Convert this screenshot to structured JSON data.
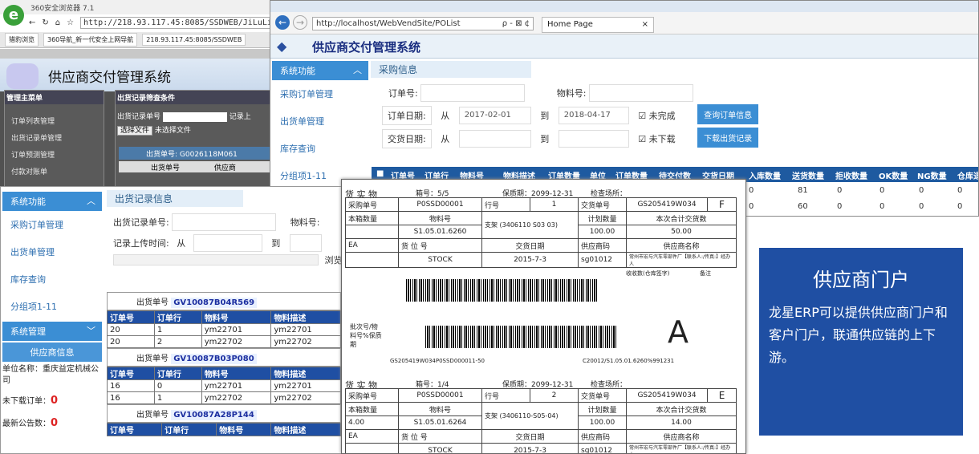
{
  "w1": {
    "title": "360安全浏览器 7.1",
    "url": "http://218.93.117.45:8085/SSDWEB/JiLuList.aspx",
    "tabs": [
      "猎豹浏览",
      "360导航_新一代安全上网导航",
      "218.93.117.45:8085/SSDWEB"
    ],
    "system_title": "供应商交付管理系统",
    "menu_title": "管理主菜单",
    "menu_items": [
      "订单列表管理",
      "出货记录单管理",
      "订单预测管理",
      "付款对账单"
    ],
    "filter_title": "出货记录筛查条件",
    "filter_label": "出货记录单号",
    "choose_file": "选择文件",
    "no_file": "未选择文件",
    "ship_no_header": "出货单号: G0026118M061",
    "col_ship": "出货单号",
    "col_supplier": "供应商",
    "record_cut": "记录上"
  },
  "w2": {
    "url": "http://localhost/WebVendSite/POList",
    "search": "ρ - ⊠ ¢",
    "tab": "Home Page",
    "system_title": "供应商交付管理系统",
    "side_title": "系统功能",
    "side_items": [
      "采购订单管理",
      "出货单管理",
      "库存查询",
      "分组项1-11"
    ],
    "section": "采购信息",
    "order_no_label": "订单号:",
    "material_label": "物料号:",
    "order_date_label": "订单日期:",
    "from": "从",
    "to": "到",
    "date_from": "2017-02-01",
    "date_to": "2018-04-17",
    "unfinished": "未完成",
    "not_downloaded": "未下载",
    "deliv_date_label": "交货日期:",
    "btn_query": "查询订单信息",
    "btn_download": "下载出货记录",
    "columns": [
      "订单号",
      "订单行",
      "物料号",
      "物料描述",
      "订单数量",
      "单位",
      "订单数量",
      "待交付数",
      "交货日期",
      "入库数量",
      "送货数量",
      "拒收数量",
      "OK数量",
      "NG数量",
      "仓库退"
    ],
    "rows": [
      [
        "0",
        "81",
        "0",
        "0",
        "0",
        "0"
      ],
      [
        "0",
        "60",
        "0",
        "0",
        "0",
        "0"
      ]
    ]
  },
  "w3": {
    "side_title": "系统功能",
    "side_items": [
      "采购订单管理",
      "出货单管理",
      "库存查询",
      "分组项1-11"
    ],
    "sys_mgmt": "系统管理",
    "supplier_info": "供应商信息",
    "company": "单位名称：重庆益定机械公司",
    "undownloaded_label": "未下载订单：",
    "undownloaded_value": "0",
    "notice_label": "最新公告数：",
    "notice_value": "0",
    "section": "出货记录信息",
    "record_no_label": "出货记录单号:",
    "material_label": "物料号:",
    "upload_time_label": "记录上传时间:",
    "from": "从",
    "to": "到",
    "browse": "浏览",
    "shipments": [
      {
        "label": "出货单号",
        "no": "GV10087B04R569",
        "rows": [
          [
            "20",
            "1",
            "ym22701",
            "ym22701"
          ],
          [
            "20",
            "2",
            "ym22702",
            "ym22702"
          ]
        ]
      },
      {
        "label": "出货单号",
        "no": "GV10087B03P080",
        "rows": [
          [
            "16",
            "0",
            "ym22701",
            "ym22701"
          ],
          [
            "16",
            "1",
            "ym22702",
            "ym22702"
          ]
        ]
      },
      {
        "label": "出货单号",
        "no": "GV10087A28P144",
        "rows": []
      }
    ],
    "cols": [
      "订单号",
      "订单行",
      "物料号",
      "物料描述"
    ]
  },
  "doc": {
    "labels": [
      {
        "head": "货 实 物",
        "box": "箱号：5/5",
        "shelf": "保质期：2099-12-31",
        "check": "检查场所：",
        "po_label": "采购单号",
        "po": "P0SSD00001",
        "line_label": "行号",
        "line": "1",
        "deliv_label": "交货单号",
        "deliv": "GS205419W034",
        "grade": "F",
        "box_qty_label": "本箱数量",
        "part_label": "物料号",
        "desc": "支架 (3406110 S03 03)",
        "plan_label": "计划数量",
        "total_label": "本次合计交货数",
        "box_qty": "",
        "part": "S1.05.01.6260",
        "plan": "100.00",
        "total": "50.00",
        "ea": "EA",
        "loc_label": "货 位 号",
        "date_label": "交货日期",
        "sup_code_label": "供应商码",
        "sup_name_label": "供应商名称",
        "loc": "STOCK",
        "date": "2015-7-3",
        "sup_code": "sg01012",
        "sup_name": "常州市宏与汽车零部件厂【联系人:/传真:】经办人",
        "recv": "收收数(仓库签字)",
        "note": "备注",
        "batch": "批次号/物料号%保质期",
        "big": "A",
        "code1": "GS205419W034P0SSD000011-50",
        "code2": "C20012/S1.05.01.6260%991231"
      },
      {
        "head": "货 实 物",
        "box": "箱号：1/4",
        "shelf": "保质期：2099-12-31",
        "check": "检查场所：",
        "po_label": "采购单号",
        "po": "P0SSD00001",
        "line_label": "行号",
        "line": "2",
        "deliv_label": "交货单号",
        "deliv": "GS205419W034",
        "grade": "E",
        "box_qty_label": "本箱数量",
        "part_label": "物料号",
        "desc": "支架 (3406110-S05-04)",
        "plan_label": "计划数量",
        "total_label": "本次合计交货数",
        "box_qty": "4.00",
        "part": "S1.05.01.6264",
        "plan": "100.00",
        "total": "14.00",
        "ea": "EA",
        "loc_label": "货 位 号",
        "date_label": "交货日期",
        "sup_code_label": "供应商码",
        "sup_name_label": "供应商名称",
        "loc": "STOCK",
        "date": "2015-7-3",
        "sup_code": "sg01012",
        "sup_name": "常州市宏与汽车零部件厂【联系人:/传真:】经办人"
      }
    ]
  },
  "promo": {
    "title": "供应商门户",
    "body": "龙星ERP可以提供供应商门户和客户门户，联通供应链的上下游。"
  }
}
